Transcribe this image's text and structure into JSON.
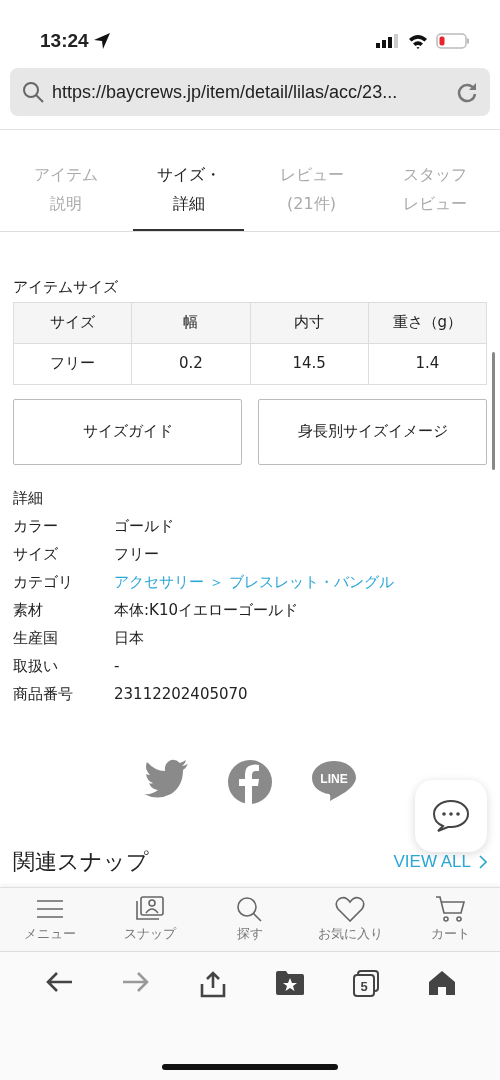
{
  "status_bar": {
    "time": "13:24"
  },
  "address_bar": {
    "url": "https://baycrews.jp/item/detail/lilas/acc/23..."
  },
  "tabs": [
    {
      "lines": [
        "アイテム",
        "説明"
      ],
      "selected": false
    },
    {
      "lines": [
        "サイズ・",
        "詳細"
      ],
      "selected": true
    },
    {
      "lines": [
        "レビュー",
        "(21件)"
      ],
      "selected": false
    },
    {
      "lines": [
        "スタッフ",
        "レビュー"
      ],
      "selected": false
    }
  ],
  "size_table": {
    "title": "アイテムサイズ",
    "columns": [
      "サイズ",
      "幅",
      "内寸",
      "重さ（g）"
    ],
    "rows": [
      [
        "フリー",
        "0.2",
        "14.5",
        "1.4"
      ]
    ]
  },
  "size_buttons": [
    "サイズガイド",
    "身長別サイズイメージ"
  ],
  "details": {
    "title": "詳細",
    "rows": [
      {
        "label": "カラー",
        "value": "ゴールド",
        "kind": "text"
      },
      {
        "label": "サイズ",
        "value": "フリー",
        "kind": "text"
      },
      {
        "label": "カテゴリ",
        "value": "アクセサリー ＞ ブレスレット・バングル",
        "kind": "link"
      },
      {
        "label": "素材",
        "value": "本体:K10イエローゴールド",
        "kind": "text"
      },
      {
        "label": "生産国",
        "value": "日本",
        "kind": "text"
      },
      {
        "label": "取扱い",
        "value": "-",
        "kind": "text"
      },
      {
        "label": "商品番号",
        "value": "23112202405070",
        "kind": "text"
      }
    ]
  },
  "share": [
    {
      "kind": "twitter"
    },
    {
      "kind": "facebook"
    },
    {
      "kind": "line",
      "label": "LINE"
    }
  ],
  "related": {
    "title": "関連スナップ",
    "link": "VIEW ALL"
  },
  "bottom_nav": [
    {
      "kind": "menu",
      "label": "メニュー"
    },
    {
      "kind": "snap",
      "label": "スナップ"
    },
    {
      "kind": "search",
      "label": "探す"
    },
    {
      "kind": "heart",
      "label": "お気に入り"
    },
    {
      "kind": "cart",
      "label": "カート"
    }
  ],
  "browser_toolbar": {
    "tab_count": "5"
  }
}
